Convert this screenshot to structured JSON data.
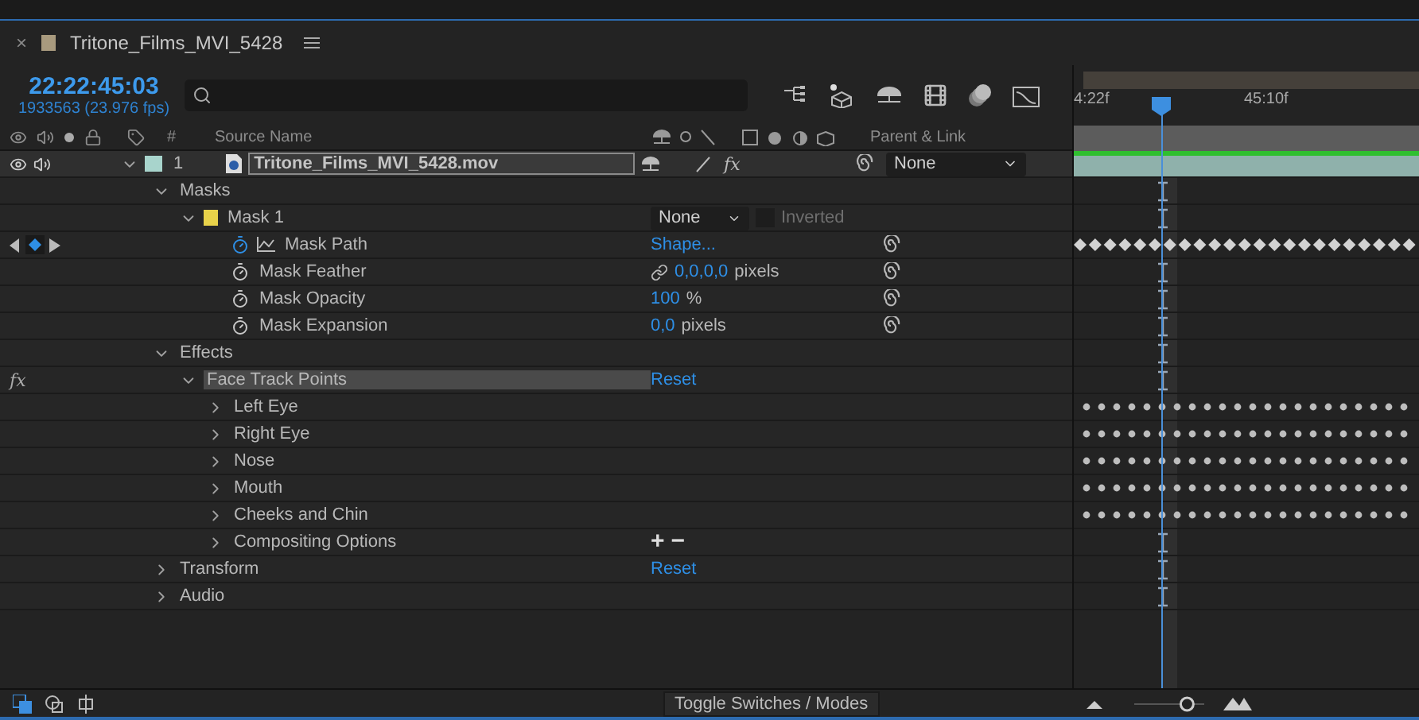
{
  "panel": {
    "close": "×",
    "title": "Tritone_Films_MVI_5428",
    "color": "#a89a7e"
  },
  "timecode": "22:22:45:03",
  "frame_info": "1933563 (23.976 fps)",
  "ruler": {
    "labels": [
      "4:22f",
      "45:10f"
    ]
  },
  "columns": {
    "number": "#",
    "source": "Source Name",
    "parent": "Parent & Link"
  },
  "layer": {
    "number": "1",
    "name": "Tritone_Films_MVI_5428.mov",
    "color": "#a8d4cc",
    "expanded": true,
    "visible": true,
    "audio": true,
    "effects_switch": "fx",
    "parent": "None"
  },
  "properties": [
    {
      "kind": "group",
      "label": "Masks",
      "expanded": true,
      "selected": false,
      "children": [
        {
          "kind": "mask",
          "label": "Mask 1",
          "expanded": true,
          "selected": false,
          "color": "#e8d24a",
          "mode": "None",
          "inverted_label": "Inverted",
          "inverted": false,
          "children": [
            {
              "kind": "property",
              "label": "Mask Path",
              "selected": false,
              "animated": true,
              "value": "Shape..."
            },
            {
              "kind": "property",
              "label": "Mask Feather",
              "selected": false,
              "animated": false,
              "linked": true,
              "value": "0,0,0,0",
              "unit": "pixels"
            },
            {
              "kind": "property",
              "label": "Mask Opacity",
              "selected": false,
              "animated": false,
              "value": "100",
              "unit": "%"
            },
            {
              "kind": "property",
              "label": "Mask Expansion",
              "selected": false,
              "animated": false,
              "value": "0,0",
              "unit": "pixels"
            }
          ]
        }
      ]
    },
    {
      "kind": "group",
      "label": "Effects",
      "expanded": true,
      "selected": false,
      "children": [
        {
          "kind": "effect",
          "icon": "fx",
          "label": "Face Track Points",
          "expanded": true,
          "selected": true,
          "action": "Reset",
          "children": [
            {
              "kind": "group",
              "label": "Left Eye",
              "expanded": false,
              "selected": false,
              "animated": true
            },
            {
              "kind": "group",
              "label": "Right Eye",
              "expanded": false,
              "selected": false,
              "animated": true
            },
            {
              "kind": "group",
              "label": "Nose",
              "expanded": false,
              "selected": false,
              "animated": true
            },
            {
              "kind": "group",
              "label": "Mouth",
              "expanded": false,
              "selected": false,
              "animated": true
            },
            {
              "kind": "group",
              "label": "Cheeks and Chin",
              "expanded": false,
              "selected": false,
              "animated": true
            },
            {
              "kind": "group",
              "label": "Compositing Options",
              "expanded": false,
              "selected": false,
              "buttons": [
                "+",
                "−"
              ]
            }
          ]
        }
      ]
    },
    {
      "kind": "group",
      "label": "Transform",
      "expanded": false,
      "selected": false,
      "action": "Reset"
    },
    {
      "kind": "group",
      "label": "Audio",
      "expanded": false,
      "selected": false
    }
  ],
  "footer": {
    "toggle": "Toggle Switches / Modes",
    "zoom": {
      "level": 0.78
    }
  }
}
